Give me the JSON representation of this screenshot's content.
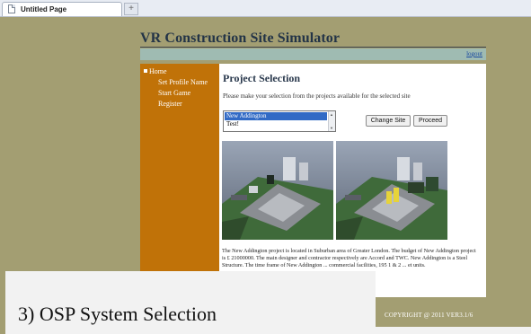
{
  "browser": {
    "tab_title": "Untitled Page",
    "new_tab_symbol": "+"
  },
  "site": {
    "title": "VR Construction Site Simulator",
    "logout": "logout",
    "footer": "COPYRIGHT @ 2011 VER3.1/6"
  },
  "sidebar": {
    "home": "Home",
    "items": [
      "Set Profile Name",
      "Start Game",
      "Register"
    ]
  },
  "main": {
    "heading": "Project Selection",
    "description": "Please make your selection from the projects available for the selected site",
    "projects": [
      "New Addington",
      "Test!"
    ],
    "selected_project": "New Addington",
    "change_site_label": "Change Site",
    "proceed_label": "Proceed",
    "paragraph": "The New Addington project is located in Suburban area of Greater London. The budget of New Addington project is £ 21000000. The main designer and contractor respectively are Accord and TWC. New Addington is a Steel Structure. The time frame of New Addington ... commercial facilities, 195 1 & 2 ... et units."
  },
  "caption": "3) OSP System Selection",
  "colors": {
    "background": "#a39e72",
    "sidebar": "#c07208",
    "topbar": "#9fbbb2",
    "selection": "#316ac5"
  }
}
